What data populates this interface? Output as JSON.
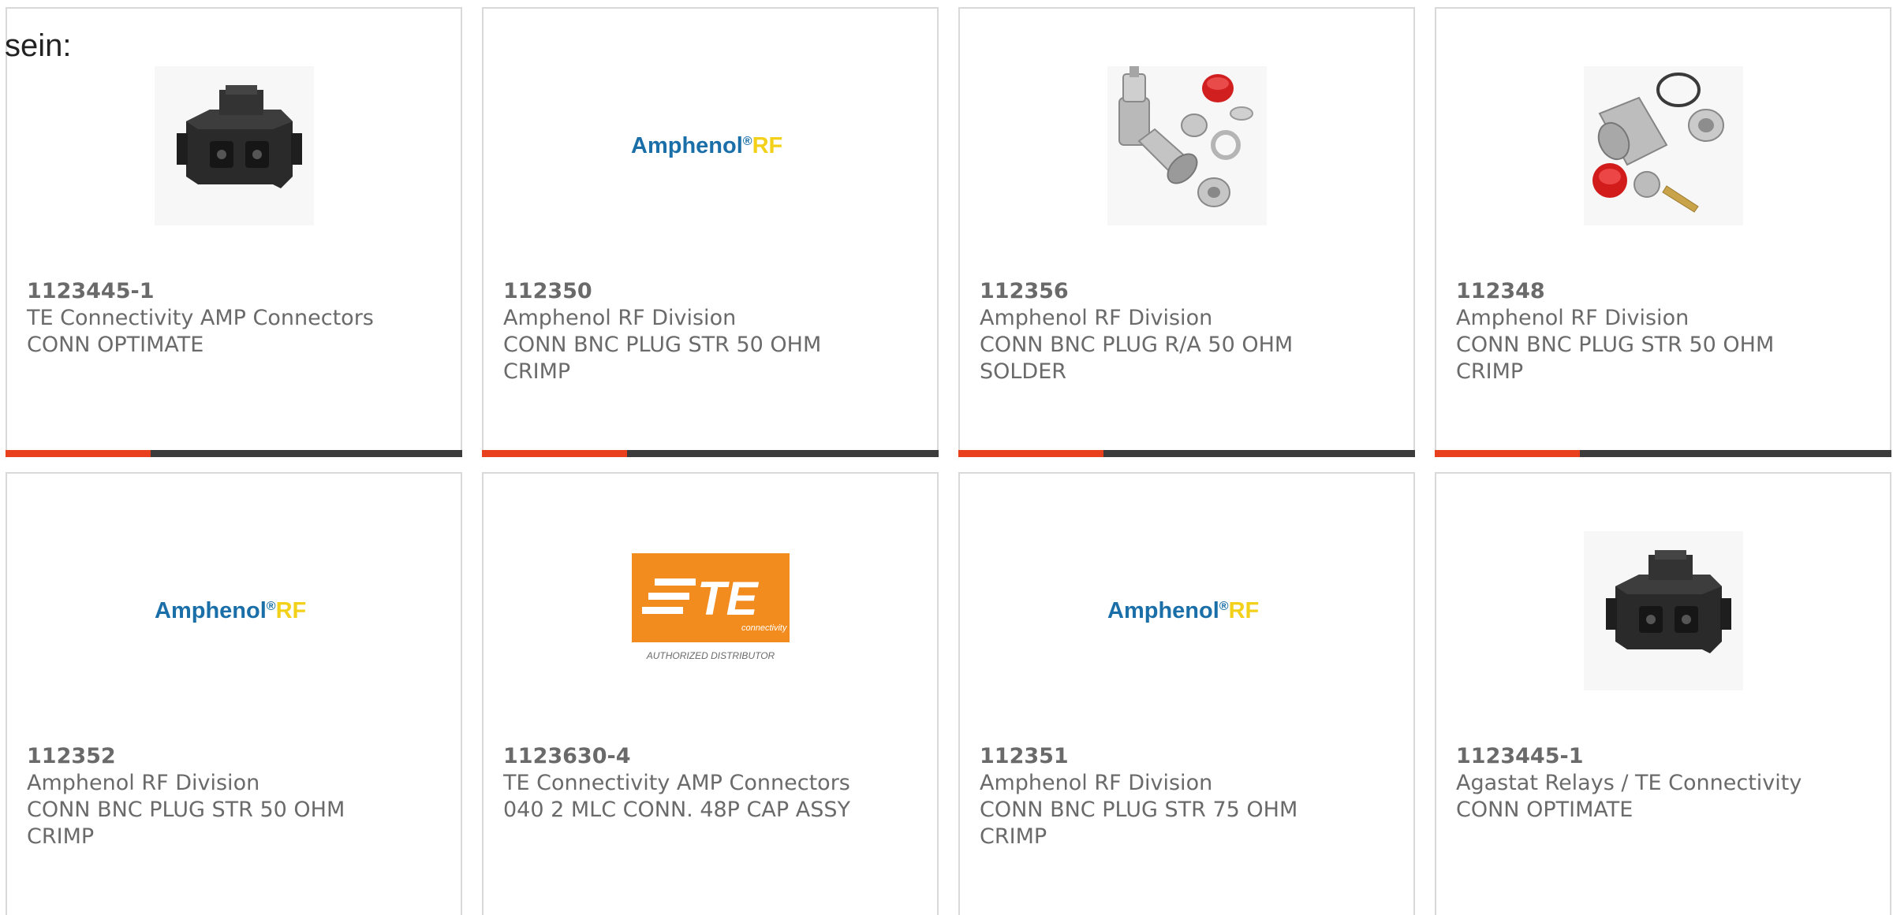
{
  "intro_text": "sein:",
  "products": [
    {
      "part_number": "1123445-1",
      "manufacturer": "TE Connectivity AMP Connectors",
      "desc_line1": "CONN OPTIMATE",
      "desc_line2": "",
      "image_icon": "black-fiber-connector-adapter"
    },
    {
      "part_number": "112350",
      "manufacturer": "Amphenol RF Division",
      "desc_line1": "CONN BNC PLUG STR 50 OHM",
      "desc_line2": "CRIMP",
      "image_icon": "amphenol-rf-logo",
      "logo_text_main": "Amphenol",
      "logo_text_reg": "®",
      "logo_text_rf": "RF"
    },
    {
      "part_number": "112356",
      "manufacturer": "Amphenol RF Division",
      "desc_line1": "CONN BNC PLUG R/A 50 OHM",
      "desc_line2": "SOLDER",
      "image_icon": "bnc-right-angle-plug-kit"
    },
    {
      "part_number": "112348",
      "manufacturer": "Amphenol RF Division",
      "desc_line1": "CONN BNC PLUG STR 50 OHM",
      "desc_line2": "CRIMP",
      "image_icon": "bnc-straight-plug-kit"
    },
    {
      "part_number": "112352",
      "manufacturer": "Amphenol RF Division",
      "desc_line1": "CONN BNC PLUG STR 50 OHM",
      "desc_line2": "CRIMP",
      "image_icon": "amphenol-rf-logo",
      "logo_text_main": "Amphenol",
      "logo_text_reg": "®",
      "logo_text_rf": "RF"
    },
    {
      "part_number": "1123630-4",
      "manufacturer": "TE Connectivity AMP Connectors",
      "desc_line1": "040 2 MLC CONN. 48P CAP ASSY",
      "desc_line2": "",
      "image_icon": "te-connectivity-logo",
      "logo_text_main": "TE",
      "logo_text_sub": "connectivity",
      "logo_caption": "AUTHORIZED DISTRIBUTOR"
    },
    {
      "part_number": "112351",
      "manufacturer": "Amphenol RF Division",
      "desc_line1": "CONN BNC PLUG STR 75 OHM",
      "desc_line2": "CRIMP",
      "image_icon": "amphenol-rf-logo",
      "logo_text_main": "Amphenol",
      "logo_text_reg": "®",
      "logo_text_rf": "RF"
    },
    {
      "part_number": "1123445-1",
      "manufacturer": "Agastat Relays / TE Connectivity",
      "desc_line1": "CONN OPTIMATE",
      "desc_line2": "",
      "image_icon": "black-fiber-connector-adapter"
    }
  ],
  "colors": {
    "accent": "#e8401c",
    "bar_dark": "#3c3c3c",
    "text": "#6a6a6a",
    "amphenol_blue": "#1b6fa8",
    "amphenol_yellow": "#f3d11a",
    "te_orange": "#f28c1e"
  }
}
